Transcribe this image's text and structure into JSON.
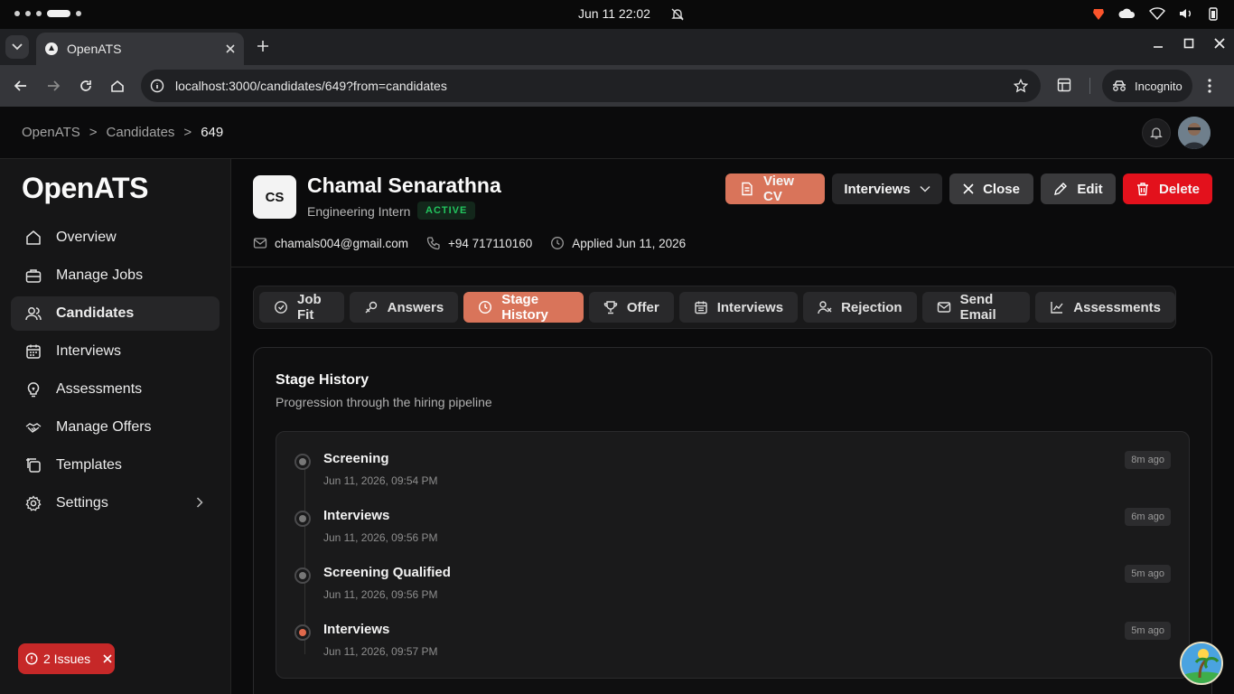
{
  "os": {
    "clock": "Jun 11  22:02"
  },
  "browser": {
    "tab_title": "OpenATS",
    "url": "localhost:3000/candidates/649?from=candidates",
    "incognito_label": "Incognito"
  },
  "breadcrumb": [
    "OpenATS",
    ">",
    "Candidates",
    ">",
    "649"
  ],
  "sidebar": {
    "brand": "OpenATS",
    "items": [
      {
        "label": "Overview",
        "icon": "home-icon"
      },
      {
        "label": "Manage Jobs",
        "icon": "briefcase-icon"
      },
      {
        "label": "Candidates",
        "icon": "users-icon",
        "active": true
      },
      {
        "label": "Interviews",
        "icon": "calendar-icon"
      },
      {
        "label": "Assessments",
        "icon": "lightbulb-icon"
      },
      {
        "label": "Manage Offers",
        "icon": "handshake-icon"
      },
      {
        "label": "Templates",
        "icon": "copy-plus-icon"
      },
      {
        "label": "Settings",
        "icon": "gear-icon"
      }
    ],
    "issues_label": "2 Issues"
  },
  "candidate": {
    "initials": "CS",
    "name": "Chamal Senarathna",
    "role": "Engineering Intern",
    "status": "ACTIVE",
    "email": "chamals004@gmail.com",
    "phone": "+94 717110160",
    "applied": "Applied Jun 11, 2026"
  },
  "actions": {
    "view_cv": "View CV",
    "interviews": "Interviews",
    "close": "Close",
    "edit": "Edit",
    "delete": "Delete"
  },
  "tabs": [
    {
      "label": "Job Fit",
      "icon": "target-icon"
    },
    {
      "label": "Answers",
      "icon": "chat-icon"
    },
    {
      "label": "Stage History",
      "icon": "clock-icon",
      "active": true
    },
    {
      "label": "Offer",
      "icon": "trophy-icon"
    },
    {
      "label": "Interviews",
      "icon": "calendar-icon"
    },
    {
      "label": "Rejection",
      "icon": "user-x-icon"
    },
    {
      "label": "Send Email",
      "icon": "mail-icon"
    },
    {
      "label": "Assessments",
      "icon": "chart-icon"
    }
  ],
  "stage_history": {
    "title": "Stage History",
    "subtitle": "Progression through the hiring pipeline",
    "entries": [
      {
        "stage": "Screening",
        "date": "Jun 11, 2026, 09:54 PM",
        "ago": "8m ago"
      },
      {
        "stage": "Interviews",
        "date": "Jun 11, 2026, 09:56 PM",
        "ago": "6m ago"
      },
      {
        "stage": "Screening Qualified",
        "date": "Jun 11, 2026, 09:56 PM",
        "ago": "5m ago"
      },
      {
        "stage": "Interviews",
        "date": "Jun 11, 2026, 09:57 PM",
        "ago": "5m ago",
        "current": true
      }
    ]
  },
  "colors": {
    "accent": "#d9745a",
    "danger": "#e3111c",
    "success": "#22c55e"
  }
}
